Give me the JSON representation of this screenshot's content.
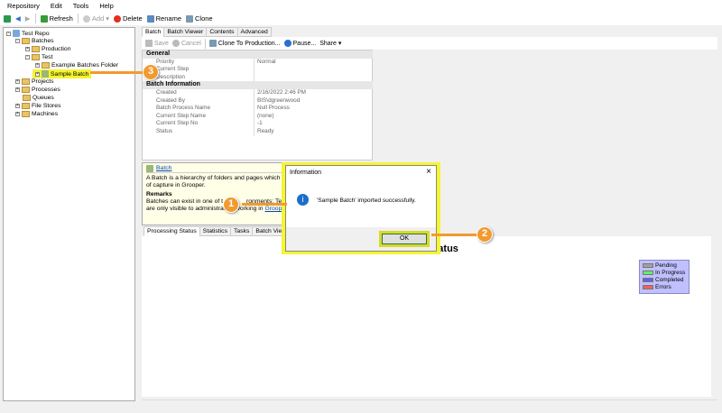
{
  "menu": [
    "Repository",
    "Edit",
    "Tools",
    "Help"
  ],
  "toolbar": {
    "refresh": "Refresh",
    "add": "Add",
    "delete": "Delete",
    "rename": "Rename",
    "clone": "Clone"
  },
  "tree": {
    "root": "Test Repo",
    "batches": "Batches",
    "production": "Production",
    "test": "Test",
    "example_folder": "Example Batches Folder",
    "sample_batch": "Sample Batch",
    "projects": "Projects",
    "processes": "Processes",
    "queues": "Queues",
    "file_stores": "File Stores",
    "machines": "Machines"
  },
  "tabs": [
    "Batch",
    "Batch Viewer",
    "Contents",
    "Advanced"
  ],
  "subtoolbar": {
    "save": "Save",
    "cancel": "Cancel",
    "clone_prod": "Clone To Production...",
    "pause": "Pause...",
    "share": "Share"
  },
  "props": {
    "general": "General",
    "batch_info": "Batch Information",
    "general_rows": [
      [
        "Priority",
        "Normal"
      ],
      [
        "Current Step",
        ""
      ],
      [
        "Description",
        ""
      ]
    ],
    "info_rows": [
      [
        "Created",
        "2/16/2022 2:46 PM"
      ],
      [
        "Created By",
        "BIS\\dgreenwood"
      ],
      [
        "Batch Process Name",
        "Null Process"
      ],
      [
        "Current Step Name",
        "(none)"
      ],
      [
        "Current Step No",
        "-1"
      ],
      [
        "Status",
        "Ready"
      ]
    ]
  },
  "help": {
    "title": "Batch",
    "line1": "A Batch is a hierarchy of folders and pages which se",
    "line2": "of capture in Grooper.",
    "remarks": "Remarks",
    "line3": "Batches can exist in one of t",
    "line3b": "ronments: Tes",
    "line4": "are only visible to administrators working in ",
    "link": "Grooper"
  },
  "bottom_tabs": [
    "Processing Status",
    "Statistics",
    "Tasks",
    "Batch Viewer",
    "F"
  ],
  "chart_data": {
    "type": "bar",
    "title": "Task Status",
    "series": [
      {
        "name": "Pending",
        "color": "#a0a0a0",
        "values": []
      },
      {
        "name": "In Progress",
        "color": "#60f060",
        "values": []
      },
      {
        "name": "Completed",
        "color": "#6060f0",
        "values": []
      },
      {
        "name": "Errors",
        "color": "#f06060",
        "values": []
      }
    ],
    "legend": "top-right"
  },
  "dialog": {
    "title": "Information",
    "message": "'Sample Batch' imported successfully.",
    "ok": "OK",
    "close": "×"
  },
  "callouts": [
    "1",
    "2",
    "3"
  ],
  "colors": {
    "highlight": "#f5f530",
    "callout": "#f29a2e"
  }
}
